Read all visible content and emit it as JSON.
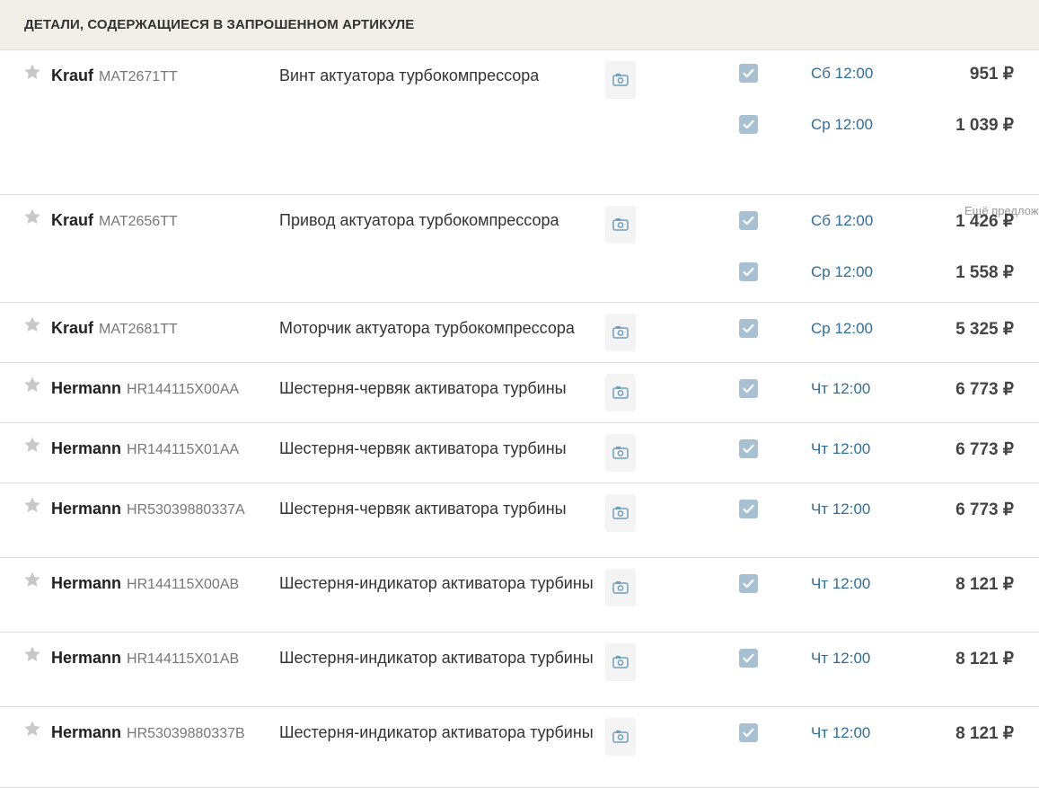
{
  "header": {
    "title": "ДЕТАЛИ, СОДЕРЖАЩИЕСЯ В ЗАПРОШЕННОМ АРТИКУЛЕ"
  },
  "rows": [
    {
      "brand": "Krauf",
      "article": "MAT2671TT",
      "description": "Винт актуатора турбокомпрессора",
      "offers": [
        {
          "delivery": "Сб 12:00",
          "price": "951 ₽"
        },
        {
          "delivery": "Ср 12:00",
          "price": "1 039 ₽"
        }
      ],
      "more_label": "Ещё предлож"
    },
    {
      "brand": "Krauf",
      "article": "MAT2656TT",
      "description": "Привод актуатора турбокомпрессора",
      "offers": [
        {
          "delivery": "Сб 12:00",
          "price": "1 426 ₽"
        },
        {
          "delivery": "Ср 12:00",
          "price": "1 558 ₽"
        }
      ]
    },
    {
      "brand": "Krauf",
      "article": "MAT2681TT",
      "description": "Моторчик актуатора турбокомпрессора",
      "offers": [
        {
          "delivery": "Ср 12:00",
          "price": "5 325 ₽"
        }
      ]
    },
    {
      "brand": "Hermann",
      "article": "HR144115X00AA",
      "description": "Шестерня-червяк активатора турбины",
      "offers": [
        {
          "delivery": "Чт 12:00",
          "price": "6 773 ₽"
        }
      ]
    },
    {
      "brand": "Hermann",
      "article": "HR144115X01AA",
      "description": "Шестерня-червяк активатора турбины",
      "offers": [
        {
          "delivery": "Чт 12:00",
          "price": "6 773 ₽"
        }
      ]
    },
    {
      "brand": "Hermann",
      "article": "HR53039880337A",
      "description": "Шестерня-червяк активатора турбины",
      "offers": [
        {
          "delivery": "Чт 12:00",
          "price": "6 773 ₽"
        }
      ]
    },
    {
      "brand": "Hermann",
      "article": "HR144115X00AB",
      "description": "Шестерня-индикатор активатора турбины",
      "offers": [
        {
          "delivery": "Чт 12:00",
          "price": "8 121 ₽"
        }
      ]
    },
    {
      "brand": "Hermann",
      "article": "HR144115X01AB",
      "description": "Шестерня-индикатор активатора турбины",
      "offers": [
        {
          "delivery": "Чт 12:00",
          "price": "8 121 ₽"
        }
      ]
    },
    {
      "brand": "Hermann",
      "article": "HR53039880337B",
      "description": "Шестерня-индикатор активатора турбины",
      "offers": [
        {
          "delivery": "Чт 12:00",
          "price": "8 121 ₽"
        }
      ]
    }
  ],
  "icons": {
    "favorite": "star-icon",
    "photo": "camera-icon",
    "offer_checkbox": "checkmark-icon"
  },
  "colors": {
    "header_bg": "#f2efe9",
    "delivery_link": "#2f6d9a",
    "checkbox": "#a7c1d2",
    "star": "#c8c8c8"
  }
}
